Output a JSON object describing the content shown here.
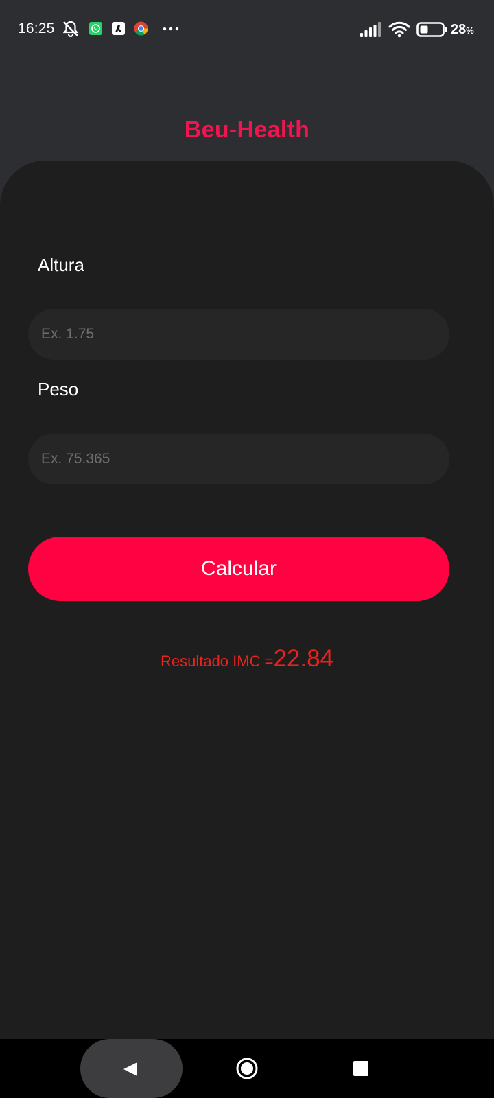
{
  "status_bar": {
    "time": "16:25",
    "battery_percent": "28",
    "battery_unit": "%",
    "icons": [
      "muted-bell-icon",
      "whatsapp-icon",
      "app-icon",
      "chrome-icon",
      "more-dots-icon",
      "signal-icon",
      "wifi-icon",
      "battery-icon"
    ]
  },
  "app": {
    "title": "Beu-Health",
    "accent_color": "#f0154f"
  },
  "form": {
    "height_label": "Altura",
    "height_placeholder": "Ex. 1.75",
    "weight_label": "Peso",
    "weight_placeholder": "Ex. 75.365",
    "calculate_label": "Calcular",
    "button_color": "#ff0242"
  },
  "result": {
    "label": "Resultado IMC =",
    "value": "22.84",
    "color": "#e8231e"
  },
  "nav_bar": {
    "icons": [
      "back-icon",
      "home-icon",
      "recents-icon"
    ]
  }
}
